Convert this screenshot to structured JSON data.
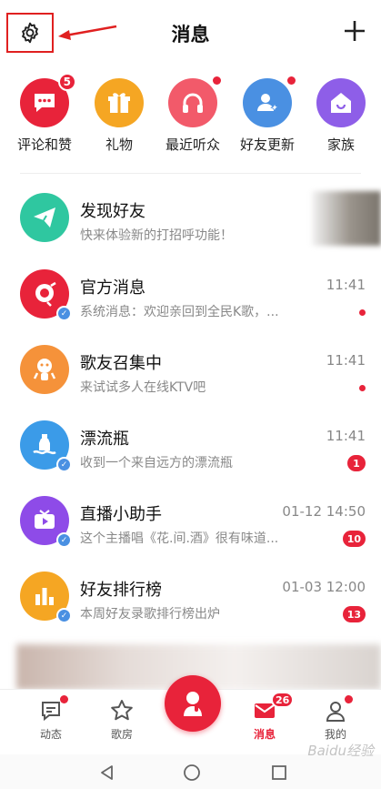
{
  "header": {
    "title": "消息"
  },
  "categories": [
    {
      "label": "评论和赞",
      "badge": "5",
      "color": "#e8233a",
      "icon": "comment-icon"
    },
    {
      "label": "礼物",
      "badge": "",
      "color": "#f5a623",
      "icon": "gift-icon"
    },
    {
      "label": "最近听众",
      "badge": "dot",
      "color": "#f25a6a",
      "icon": "headphones-icon"
    },
    {
      "label": "好友更新",
      "badge": "dot",
      "color": "#4a90e2",
      "icon": "friend-update-icon"
    },
    {
      "label": "家族",
      "badge": "",
      "color": "#8e5ee8",
      "icon": "home-icon"
    }
  ],
  "messages": [
    {
      "title": "发现好友",
      "subtitle": "快来体验新的打招呼功能！",
      "time": "",
      "badge": "",
      "color": "#2fc7a0",
      "icon": "paper-plane-icon",
      "verified": false
    },
    {
      "title": "官方消息",
      "subtitle": "系统消息：欢迎亲回到全民K歌，...",
      "time": "11:41",
      "badge": "dot",
      "color": "#e8233a",
      "icon": "official-icon",
      "verified": true
    },
    {
      "title": "歌友召集中",
      "subtitle": "来试试多人在线KTV吧",
      "time": "11:41",
      "badge": "dot",
      "color": "#f5923a",
      "icon": "ktv-icon",
      "verified": false
    },
    {
      "title": "漂流瓶",
      "subtitle": "收到一个来自远方的漂流瓶",
      "time": "11:41",
      "badge": "1",
      "color": "#3b9be8",
      "icon": "bottle-icon",
      "verified": true
    },
    {
      "title": "直播小助手",
      "subtitle": "这个主播唱《花.间.酒》很有味道...",
      "time": "01-12 14:50",
      "badge": "10",
      "color": "#8e4be8",
      "icon": "tv-icon",
      "verified": true
    },
    {
      "title": "好友排行榜",
      "subtitle": "本周好友录歌排行榜出炉",
      "time": "01-03 12:00",
      "badge": "13",
      "color": "#f5a623",
      "icon": "bar-chart-icon",
      "verified": true
    }
  ],
  "tabs": [
    {
      "label": "动态",
      "active": false,
      "badge": "dot"
    },
    {
      "label": "歌房",
      "active": false,
      "badge": ""
    },
    {
      "label": "消息",
      "active": true,
      "badge": "26"
    },
    {
      "label": "我的",
      "active": false,
      "badge": "dot"
    }
  ],
  "watermark": "Baidu经验",
  "colors": {
    "accent": "#e8233a"
  }
}
